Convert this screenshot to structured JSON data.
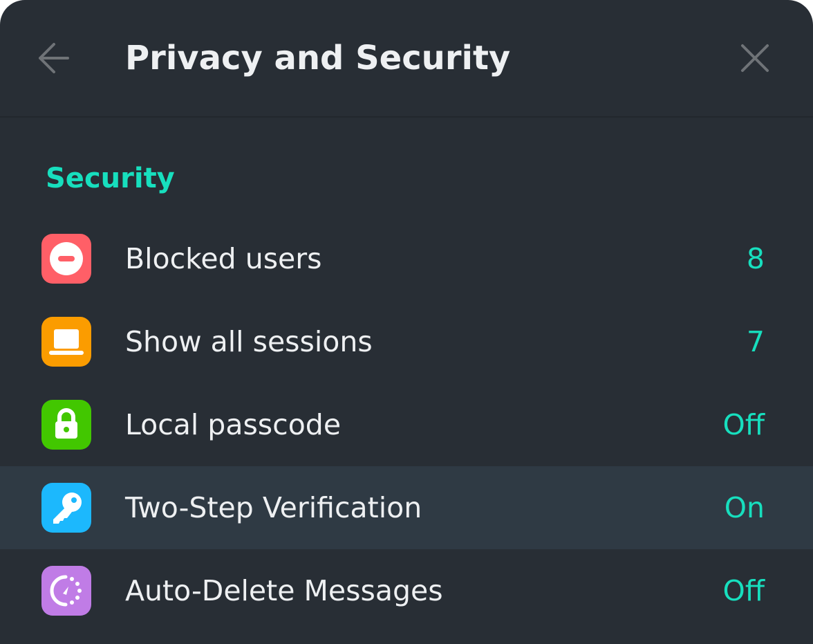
{
  "header": {
    "title": "Privacy and Security",
    "back_icon": "arrow-left-icon",
    "close_icon": "close-icon"
  },
  "section": {
    "label": "Security"
  },
  "items": [
    {
      "label": "Blocked users",
      "value": "8",
      "icon": "blocked-icon",
      "icon_color": "#ff5f67"
    },
    {
      "label": "Show all sessions",
      "value": "7",
      "icon": "laptop-icon",
      "icon_color": "#fb9c00"
    },
    {
      "label": "Local passcode",
      "value": "Off",
      "icon": "lock-icon",
      "icon_color": "#42c700"
    },
    {
      "label": "Two-Step Verification",
      "value": "On",
      "icon": "key-icon",
      "icon_color": "#1cb8fd"
    },
    {
      "label": "Auto-Delete Messages",
      "value": "Off",
      "icon": "timer-icon",
      "icon_color": "#c07ce6"
    }
  ],
  "colors": {
    "accent": "#17dfbe",
    "background": "#282e35",
    "hover_row": "#2f3a44"
  }
}
